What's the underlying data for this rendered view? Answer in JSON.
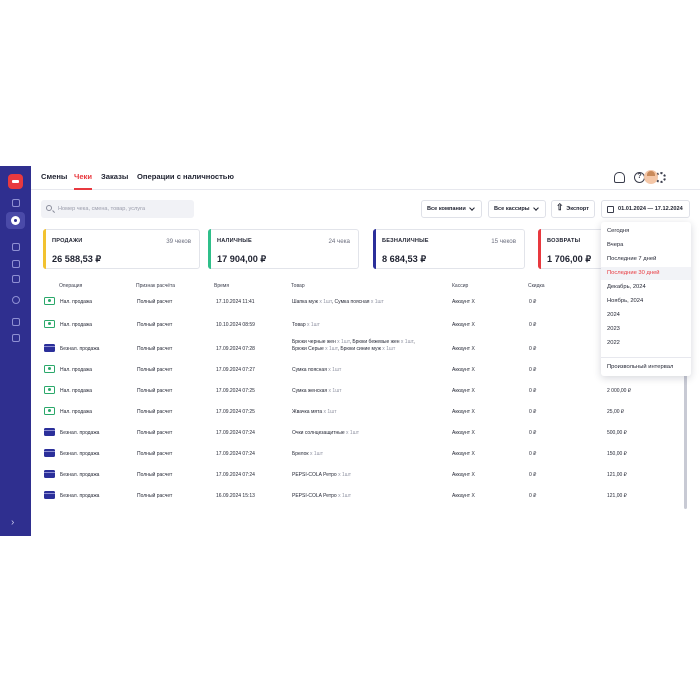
{
  "tabs": [
    "Смены",
    "Чеки",
    "Заказы",
    "Операции с наличностью"
  ],
  "active_tab": "Чеки",
  "search": {
    "placeholder": "Номер чека, смена, товар, услуга"
  },
  "filters": {
    "company": "Все компании",
    "cashiers": "Все кассиры",
    "export": "Экспорт",
    "date_range": "01.01.2024 — 17.12.2024"
  },
  "cards": [
    {
      "title": "ПРОДАЖИ",
      "count": "39 чеков",
      "value": "26 588,53 ₽",
      "color": "#f2c230"
    },
    {
      "title": "НАЛИЧНЫЕ",
      "count": "24 чека",
      "value": "17 904,00 ₽",
      "color": "#2fbf8a"
    },
    {
      "title": "БЕЗНАЛИЧНЫЕ",
      "count": "15 чеков",
      "value": "8 684,53 ₽",
      "color": "#2b2f9a"
    },
    {
      "title": "ВОЗВРАТЫ",
      "count": "",
      "value": "1 706,00 ₽",
      "color": "#e8393f"
    }
  ],
  "columns": {
    "operation": "Операция",
    "settlement": "Признак расчёта",
    "time": "Время",
    "goods": "Товар",
    "cashier": "Кассир",
    "discount": "Скидка"
  },
  "rows": [
    {
      "payment_icon": "cash-icon",
      "operation": "Нал. продажа",
      "settlement": "Полный расчет",
      "time": "17.10.2024 11:41",
      "goods": [
        {
          "name": "Шапка муж",
          "qty": " x 1шт"
        },
        {
          "name": ", Сумка поясная",
          "qty": " x 1шт"
        }
      ],
      "cashier": "Аккаунт Х",
      "discount": "0 ₽",
      "total": ""
    },
    {
      "payment_icon": "cash-icon",
      "operation": "Нал. продажа",
      "settlement": "Полный расчет",
      "time": "10.10.2024 08:59",
      "goods": [
        {
          "name": "Товар",
          "qty": " x 1шт"
        }
      ],
      "cashier": "Аккаунт Х",
      "discount": "0 ₽",
      "total": ""
    },
    {
      "payment_icon": "card-icon",
      "operation": "Безнал. продажа",
      "settlement": "Полный расчет",
      "time": "17.09.2024 07:28",
      "goods": [
        {
          "name": "Брюки черные жен",
          "qty": " x 1шт"
        },
        {
          "name": ", Брюки бежевые жен",
          "qty": " x 1шт"
        },
        {
          "name": ", Брюки Серые",
          "qty": " x 1шт"
        },
        {
          "name": ", Брюки синие муж",
          "qty": " x 1шт"
        }
      ],
      "cashier": "Аккаунт Х",
      "discount": "0 ₽",
      "total": ""
    },
    {
      "payment_icon": "cash-icon",
      "operation": "Нал. продажа",
      "settlement": "Полный расчет",
      "time": "17.09.2024 07:27",
      "goods": [
        {
          "name": "Сумка поясная",
          "qty": " x 1шт"
        }
      ],
      "cashier": "Аккаунт Х",
      "discount": "0 ₽",
      "total": ""
    },
    {
      "payment_icon": "cash-icon",
      "operation": "Нал. продажа",
      "settlement": "Полный расчет",
      "time": "17.09.2024 07:25",
      "goods": [
        {
          "name": "Сумка женская",
          "qty": " x 1шт"
        }
      ],
      "cashier": "Аккаунт Х",
      "discount": "0 ₽",
      "total": "2 000,00 ₽"
    },
    {
      "payment_icon": "cash-icon",
      "operation": "Нал. продажа",
      "settlement": "Полный расчет",
      "time": "17.09.2024 07:25",
      "goods": [
        {
          "name": "Жвачка мята",
          "qty": " x 1шт"
        }
      ],
      "cashier": "Аккаунт Х",
      "discount": "0 ₽",
      "total": "25,00 ₽"
    },
    {
      "payment_icon": "card-icon",
      "operation": "Безнал. продажа",
      "settlement": "Полный расчет",
      "time": "17.09.2024 07:24",
      "goods": [
        {
          "name": "Очки солнцезащитные",
          "qty": " x 1шт"
        }
      ],
      "cashier": "Аккаунт Х",
      "discount": "0 ₽",
      "total": "500,00 ₽"
    },
    {
      "payment_icon": "card-icon",
      "operation": "Безнал. продажа",
      "settlement": "Полный расчет",
      "time": "17.09.2024 07:24",
      "goods": [
        {
          "name": "Брелок",
          "qty": " x 1шт"
        }
      ],
      "cashier": "Аккаунт Х",
      "discount": "0 ₽",
      "total": "150,00 ₽"
    },
    {
      "payment_icon": "card-icon",
      "operation": "Безнал. продажа",
      "settlement": "Полный расчет",
      "time": "17.09.2024 07:24",
      "goods": [
        {
          "name": "PEPSI-COLA Ретро",
          "qty": " x 1шт"
        }
      ],
      "cashier": "Аккаунт Х",
      "discount": "0 ₽",
      "total": "121,00 ₽"
    },
    {
      "payment_icon": "card-icon",
      "operation": "Безнал. продажа",
      "settlement": "Полный расчет",
      "time": "16.09.2024 15:13",
      "goods": [
        {
          "name": "PEPSI-COLA Ретро",
          "qty": " x 1шт"
        }
      ],
      "cashier": "Аккаунт Х",
      "discount": "0 ₽",
      "total": "121,00 ₽"
    }
  ],
  "date_dropdown": {
    "items": [
      "Сегодня",
      "Вчера",
      "Последние 7 дней",
      "Последние 30 дней",
      "Декабрь, 2024",
      "Ноябрь, 2024",
      "2024",
      "2023",
      "2022"
    ],
    "selected": "Последние 30 дней",
    "custom": "Произвольный интервал"
  },
  "icons": {
    "sidebar": [
      "logo-icon",
      "chart-icon",
      "receipt-icon",
      "bag-icon",
      "scan-icon",
      "folder-icon",
      "gear-icon",
      "box-icon",
      "puzzle-icon"
    ],
    "top": [
      "bell-icon",
      "help-icon",
      "gear-icon",
      "avatar"
    ]
  },
  "colors": {
    "accent": "#e8393f",
    "sidebar": "#2f2f8f"
  }
}
